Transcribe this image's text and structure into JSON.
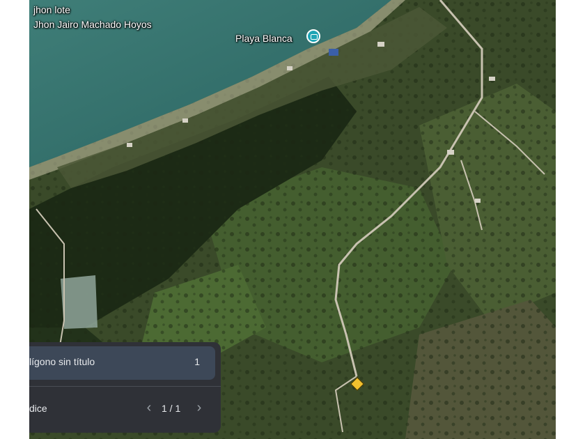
{
  "map": {
    "owner_title": "jhon lote",
    "owner_name": "Jhon Jairo Machado Hoyos",
    "place_label": "Playa Blanca",
    "place_icon": "camera-pin-icon",
    "marker_icon": "yellow-diamond-marker-icon",
    "colors": {
      "sea": "#2f6f6a",
      "forest": "#1c2a15",
      "grass": "#3e5a2a",
      "road": "#c8c2b0",
      "pin": "#1ea4b4",
      "marker": "#f2c12e"
    }
  },
  "panel": {
    "feature_name": "lígono sin título",
    "feature_count": "1",
    "index_label": "dice",
    "page_indicator": "1 / 1",
    "prev_icon": "chevron-left-icon",
    "next_icon": "chevron-right-icon"
  }
}
